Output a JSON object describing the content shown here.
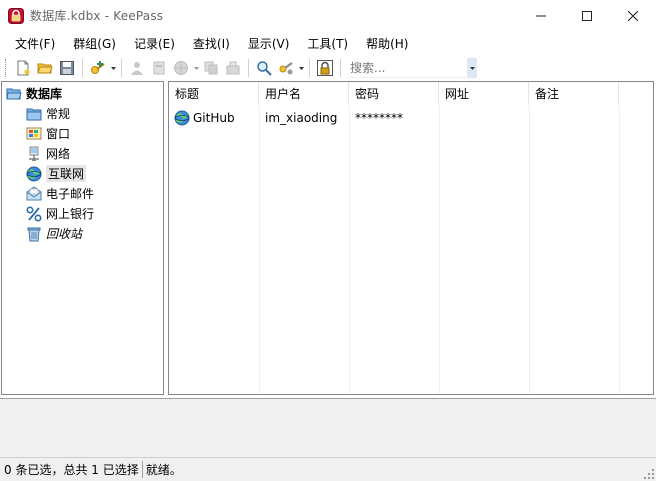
{
  "window": {
    "title": "数据库.kdbx - KeePass",
    "minimize_icon": "minimize-icon",
    "maximize_icon": "maximize-icon",
    "close_icon": "close-icon"
  },
  "menu": [
    "文件(F)",
    "群组(G)",
    "记录(E)",
    "查找(I)",
    "显示(V)",
    "工具(T)",
    "帮助(H)"
  ],
  "toolbar": {
    "search_placeholder": "搜索...",
    "icons": [
      "new-database-icon",
      "open-database-icon",
      "save-icon",
      "add-entry-icon",
      "copy-username-icon",
      "copy-password-icon",
      "open-url-icon",
      "copy-icon",
      "autotype-icon",
      "find-icon",
      "entry-view-icon",
      "lock-workspace-icon"
    ]
  },
  "tree": {
    "root": "数据库",
    "groups": [
      {
        "label": "常规",
        "icon": "folder-icon"
      },
      {
        "label": "窗口",
        "icon": "windows-icon"
      },
      {
        "label": "网络",
        "icon": "network-icon"
      },
      {
        "label": "互联网",
        "icon": "globe-icon",
        "selected": true
      },
      {
        "label": "电子邮件",
        "icon": "email-icon"
      },
      {
        "label": "网上银行",
        "icon": "percent-icon"
      },
      {
        "label": "回收站",
        "icon": "recycle-bin-icon"
      }
    ]
  },
  "list": {
    "columns": [
      "标题",
      "用户名",
      "密码",
      "网址",
      "备注"
    ],
    "rows": [
      {
        "title": "GitHub",
        "username": "im_xiaoding",
        "password": "********",
        "url": "",
        "notes": ""
      }
    ]
  },
  "status": {
    "selection": "0 条已选，总共 1 已选择",
    "state": "就绪。"
  }
}
